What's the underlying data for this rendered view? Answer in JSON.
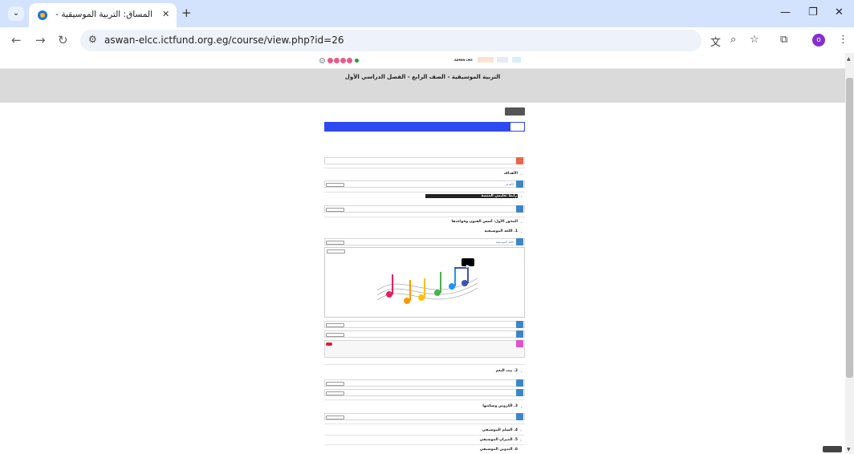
{
  "browser": {
    "tab_title": "المساق: التربية الموسيقية - الصـ",
    "url": "aswan-elcc.ictfund.org.eg/course/view.php?id=26",
    "icons": {
      "tabsearch": "chevron-down-icon",
      "close": "close-icon",
      "newtab": "plus-icon",
      "back": "back-arrow-icon",
      "forward": "forward-arrow-icon",
      "reload": "reload-icon",
      "site": "tune-icon",
      "translate": "translate-icon",
      "zoom": "zoom-icon",
      "bookmark": "star-icon",
      "extensions": "puzzle-icon",
      "menu": "kebab-menu-icon"
    },
    "profile_initial": "o"
  },
  "topbar": {
    "brand": "ADMIN LMS",
    "links": [
      "",
      "",
      ""
    ]
  },
  "course": {
    "title": "التربية الموسيقية - الصف الرابع - الفصل الدراسي الأول",
    "breadcrumb": "",
    "edit_button": "",
    "nav": [
      "",
      "",
      "",
      "",
      ""
    ]
  },
  "sections": [
    {
      "id": "general",
      "items": [
        {
          "title": "",
          "done": ""
        }
      ]
    },
    {
      "id": "objectives",
      "title": "الأهداف",
      "items": [
        {
          "title": "الأهداف",
          "done": ""
        }
      ]
    },
    {
      "id": "parents",
      "title": "رابط تعليمي المنصة",
      "items": [
        {
          "title": "",
          "done": ""
        }
      ]
    },
    {
      "id": "unit1",
      "title": "المحور الأول: أسس الفنون وقواعدها"
    },
    {
      "id": "lesson1",
      "title": "1. اللغة الموسيقية",
      "items": [
        {
          "title": "اللغة الموسيقية",
          "done": ""
        },
        {
          "title": "",
          "done": ""
        },
        {
          "title": "",
          "done": ""
        },
        {
          "title": "",
          "done": ""
        }
      ],
      "h5p_notes": [
        "",
        ""
      ]
    },
    {
      "id": "lesson2",
      "title": "2. بيت النغم",
      "items": [
        {
          "title": "",
          "done": ""
        },
        {
          "title": "",
          "done": ""
        }
      ]
    },
    {
      "id": "lesson3",
      "title": "3. الكروش وسكتتها",
      "items": [
        {
          "title": "",
          "done": ""
        }
      ]
    },
    {
      "id": "lesson4",
      "title": "4. السلم الموسيقي"
    },
    {
      "id": "lesson5",
      "title": "5. الميزان الموسيقي"
    },
    {
      "id": "lesson6",
      "title": "6. التدوين الموسيقي"
    }
  ],
  "colors": {
    "nav": "#2f49f1",
    "page_icon": "#3d86c6",
    "forum_icon": "#e8664a",
    "video_icon": "#e055c8",
    "badge": "#e0193f"
  }
}
